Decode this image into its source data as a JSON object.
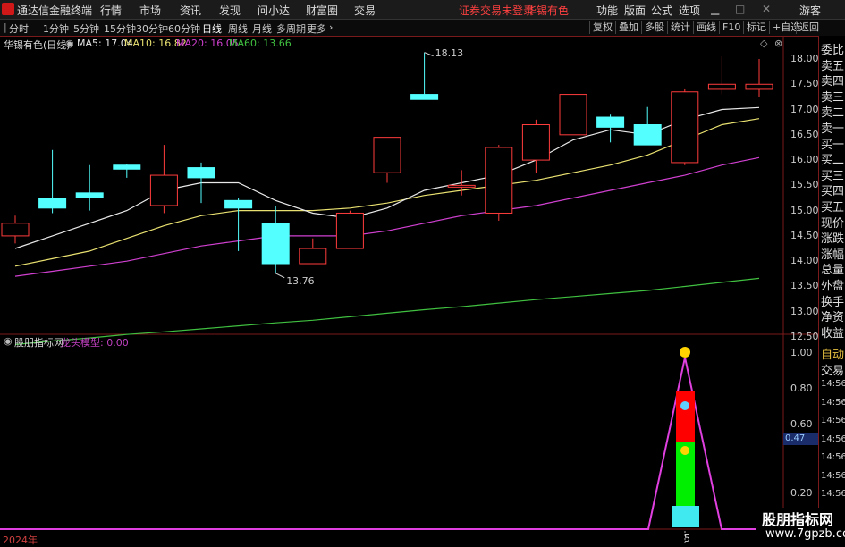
{
  "menubar": {
    "app_title": "通达信金融终端",
    "items": [
      "行情",
      "市场",
      "资讯",
      "发现",
      "问小达",
      "财富圈",
      "交易"
    ],
    "status": "证券交易未登录",
    "stock_name": "华锡有色",
    "right_items": [
      "功能",
      "版面",
      "公式",
      "选项"
    ],
    "user": "游客"
  },
  "periodbar": {
    "periods": [
      "分时",
      "1分钟",
      "5分钟",
      "15分钟",
      "30分钟",
      "60分钟",
      "日线",
      "周线",
      "月线",
      "多周期",
      "更多"
    ],
    "active": "日线",
    "tools": [
      "复权",
      "叠加",
      "多股",
      "统计",
      "画线",
      "F10",
      "标记",
      "+自选",
      "返回"
    ]
  },
  "main_chart": {
    "stock_label": "华锡有色(日线)",
    "ma": [
      {
        "label": "MA5: 17.04",
        "color": "#e8e8e8"
      },
      {
        "label": "MA10: 16.82",
        "color": "#e8e070"
      },
      {
        "label": "MA20: 16.05",
        "color": "#d040d0"
      },
      {
        "label": "MA60: 13.66",
        "color": "#40c040"
      }
    ],
    "price_ticks": [
      "18.00",
      "17.50",
      "17.00",
      "16.50",
      "16.00",
      "15.50",
      "15.00",
      "14.50",
      "14.00",
      "13.50",
      "13.00",
      "12.50"
    ],
    "high_label": "18.13",
    "low_label": "13.76"
  },
  "indicator": {
    "title": "股朋指标网",
    "name": "龙头模型: 0.00",
    "ticks": [
      "1.00",
      "0.80",
      "0.60",
      "0.47",
      "0.20"
    ],
    "highlight": "0.47"
  },
  "xaxis": {
    "year": "2024年",
    "mark": "5"
  },
  "right_panel": {
    "quote_labels": [
      "委比",
      "卖五",
      "卖四",
      "卖三",
      "卖二",
      "卖一",
      "买一",
      "买二",
      "买三",
      "买四",
      "买五",
      "现价",
      "涨跌",
      "涨幅",
      "总量",
      "外盘",
      "换手",
      "净资",
      "收益"
    ],
    "bottom_labels": [
      "自动",
      "交易"
    ],
    "times": [
      "14:56",
      "14:56",
      "14:56",
      "14:56",
      "14:56",
      "14:56",
      "14:56",
      "14:56"
    ]
  },
  "watermark": {
    "line1": "股朋指标网",
    "line2": "www.7gpzb.com"
  },
  "chart_data": {
    "type": "candlestick",
    "candles": [
      {
        "o": 14.5,
        "c": 14.75,
        "h": 14.9,
        "l": 14.35
      },
      {
        "o": 15.25,
        "c": 15.05,
        "h": 16.2,
        "l": 14.95
      },
      {
        "o": 15.35,
        "c": 15.25,
        "h": 15.9,
        "l": 15.0
      },
      {
        "o": 15.9,
        "c": 15.82,
        "h": 15.92,
        "l": 15.65
      },
      {
        "o": 15.1,
        "c": 15.7,
        "h": 16.3,
        "l": 14.95
      },
      {
        "o": 15.85,
        "c": 15.65,
        "h": 15.95,
        "l": 15.15
      },
      {
        "o": 15.2,
        "c": 15.05,
        "h": 15.25,
        "l": 14.2
      },
      {
        "o": 14.75,
        "c": 13.95,
        "h": 15.1,
        "l": 13.76
      },
      {
        "o": 13.95,
        "c": 14.25,
        "h": 14.45,
        "l": 13.95
      },
      {
        "o": 14.25,
        "c": 14.95,
        "h": 15.0,
        "l": 14.25
      },
      {
        "o": 15.75,
        "c": 16.45,
        "h": 16.45,
        "l": 15.55
      },
      {
        "o": 17.3,
        "c": 17.2,
        "h": 18.13,
        "l": 17.2
      },
      {
        "o": 15.5,
        "c": 15.5,
        "h": 15.8,
        "l": 15.3
      },
      {
        "o": 14.95,
        "c": 16.25,
        "h": 16.3,
        "l": 14.8
      },
      {
        "o": 16.0,
        "c": 16.7,
        "h": 16.8,
        "l": 15.75
      },
      {
        "o": 16.5,
        "c": 17.3,
        "h": 17.3,
        "l": 16.5
      },
      {
        "o": 16.85,
        "c": 16.65,
        "h": 16.9,
        "l": 16.35
      },
      {
        "o": 16.7,
        "c": 16.3,
        "h": 17.05,
        "l": 16.3
      },
      {
        "o": 15.95,
        "c": 17.35,
        "h": 17.4,
        "l": 15.9
      },
      {
        "o": 17.4,
        "c": 17.5,
        "h": 18.05,
        "l": 17.3
      },
      {
        "o": 17.4,
        "c": 17.5,
        "h": 18.0,
        "l": 17.25
      }
    ],
    "ma5": [
      14.25,
      14.5,
      14.75,
      15.0,
      15.4,
      15.55,
      15.55,
      15.2,
      14.95,
      14.85,
      15.05,
      15.4,
      15.55,
      15.7,
      16.0,
      16.4,
      16.6,
      16.5,
      16.8,
      17.0,
      17.04
    ],
    "ma10": [
      13.9,
      14.05,
      14.2,
      14.45,
      14.7,
      14.9,
      15.0,
      15.0,
      15.0,
      15.05,
      15.15,
      15.3,
      15.4,
      15.5,
      15.6,
      15.75,
      15.9,
      16.1,
      16.4,
      16.7,
      16.82
    ],
    "ma20": [
      13.7,
      13.8,
      13.9,
      14.0,
      14.15,
      14.3,
      14.4,
      14.5,
      14.5,
      14.5,
      14.6,
      14.75,
      14.9,
      15.0,
      15.1,
      15.25,
      15.4,
      15.55,
      15.7,
      15.9,
      16.05
    ],
    "ma60": [
      12.35,
      12.42,
      12.48,
      12.55,
      12.6,
      12.66,
      12.72,
      12.78,
      12.83,
      12.9,
      12.97,
      13.04,
      13.1,
      13.17,
      13.24,
      13.3,
      13.36,
      13.42,
      13.5,
      13.58,
      13.66
    ],
    "ylim": [
      12.2,
      18.3
    ],
    "indicator_ylim": [
      0,
      1.08
    ]
  }
}
